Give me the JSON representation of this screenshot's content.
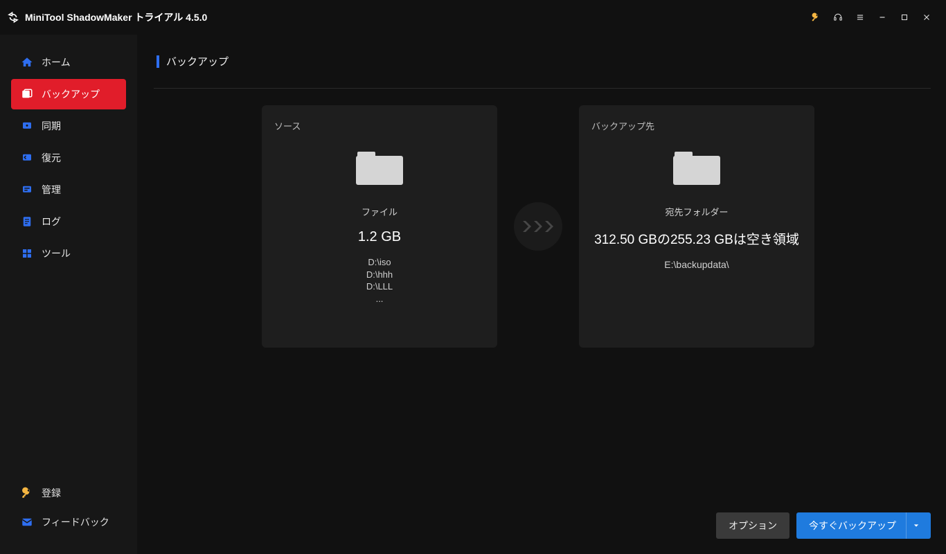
{
  "app": {
    "title": "MiniTool ShadowMaker トライアル 4.5.0"
  },
  "sidebar": {
    "items": [
      {
        "label": "ホーム"
      },
      {
        "label": "バックアップ"
      },
      {
        "label": "同期"
      },
      {
        "label": "復元"
      },
      {
        "label": "管理"
      },
      {
        "label": "ログ"
      },
      {
        "label": "ツール"
      }
    ],
    "bottom": {
      "register": "登録",
      "feedback": "フィードバック"
    }
  },
  "page": {
    "heading": "バックアップ"
  },
  "source": {
    "label": "ソース",
    "type": "ファイル",
    "size": "1.2 GB",
    "paths": [
      "D:\\iso",
      "D:\\hhh",
      "D:\\LLL",
      "..."
    ]
  },
  "destination": {
    "label": "バックアップ先",
    "type": "宛先フォルダー",
    "space": "312.50 GBの255.23 GBは空き領域",
    "path": "E:\\backupdata\\"
  },
  "footer": {
    "options": "オプション",
    "backup_now": "今すぐバックアップ"
  }
}
